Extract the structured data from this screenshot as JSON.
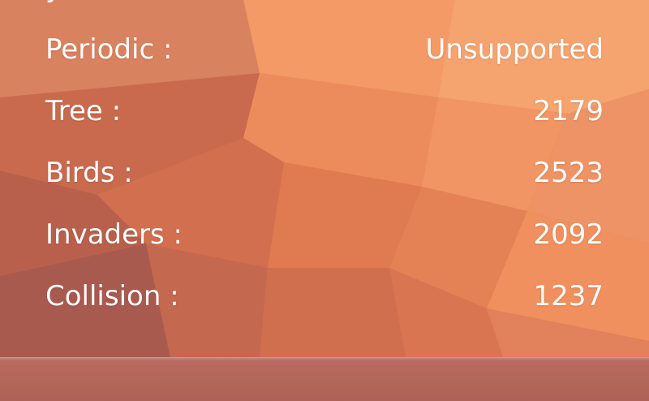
{
  "colors": {
    "base": "#d9774f",
    "text": "#ffffff"
  },
  "partial_row": {
    "label": "y"
  },
  "benchmarks": [
    {
      "label": "Periodic :",
      "value": "Unsupported"
    },
    {
      "label": "Tree :",
      "value": "2179"
    },
    {
      "label": "Birds :",
      "value": "2523"
    },
    {
      "label": "Invaders :",
      "value": "2092"
    },
    {
      "label": "Collision :",
      "value": "1237"
    }
  ]
}
